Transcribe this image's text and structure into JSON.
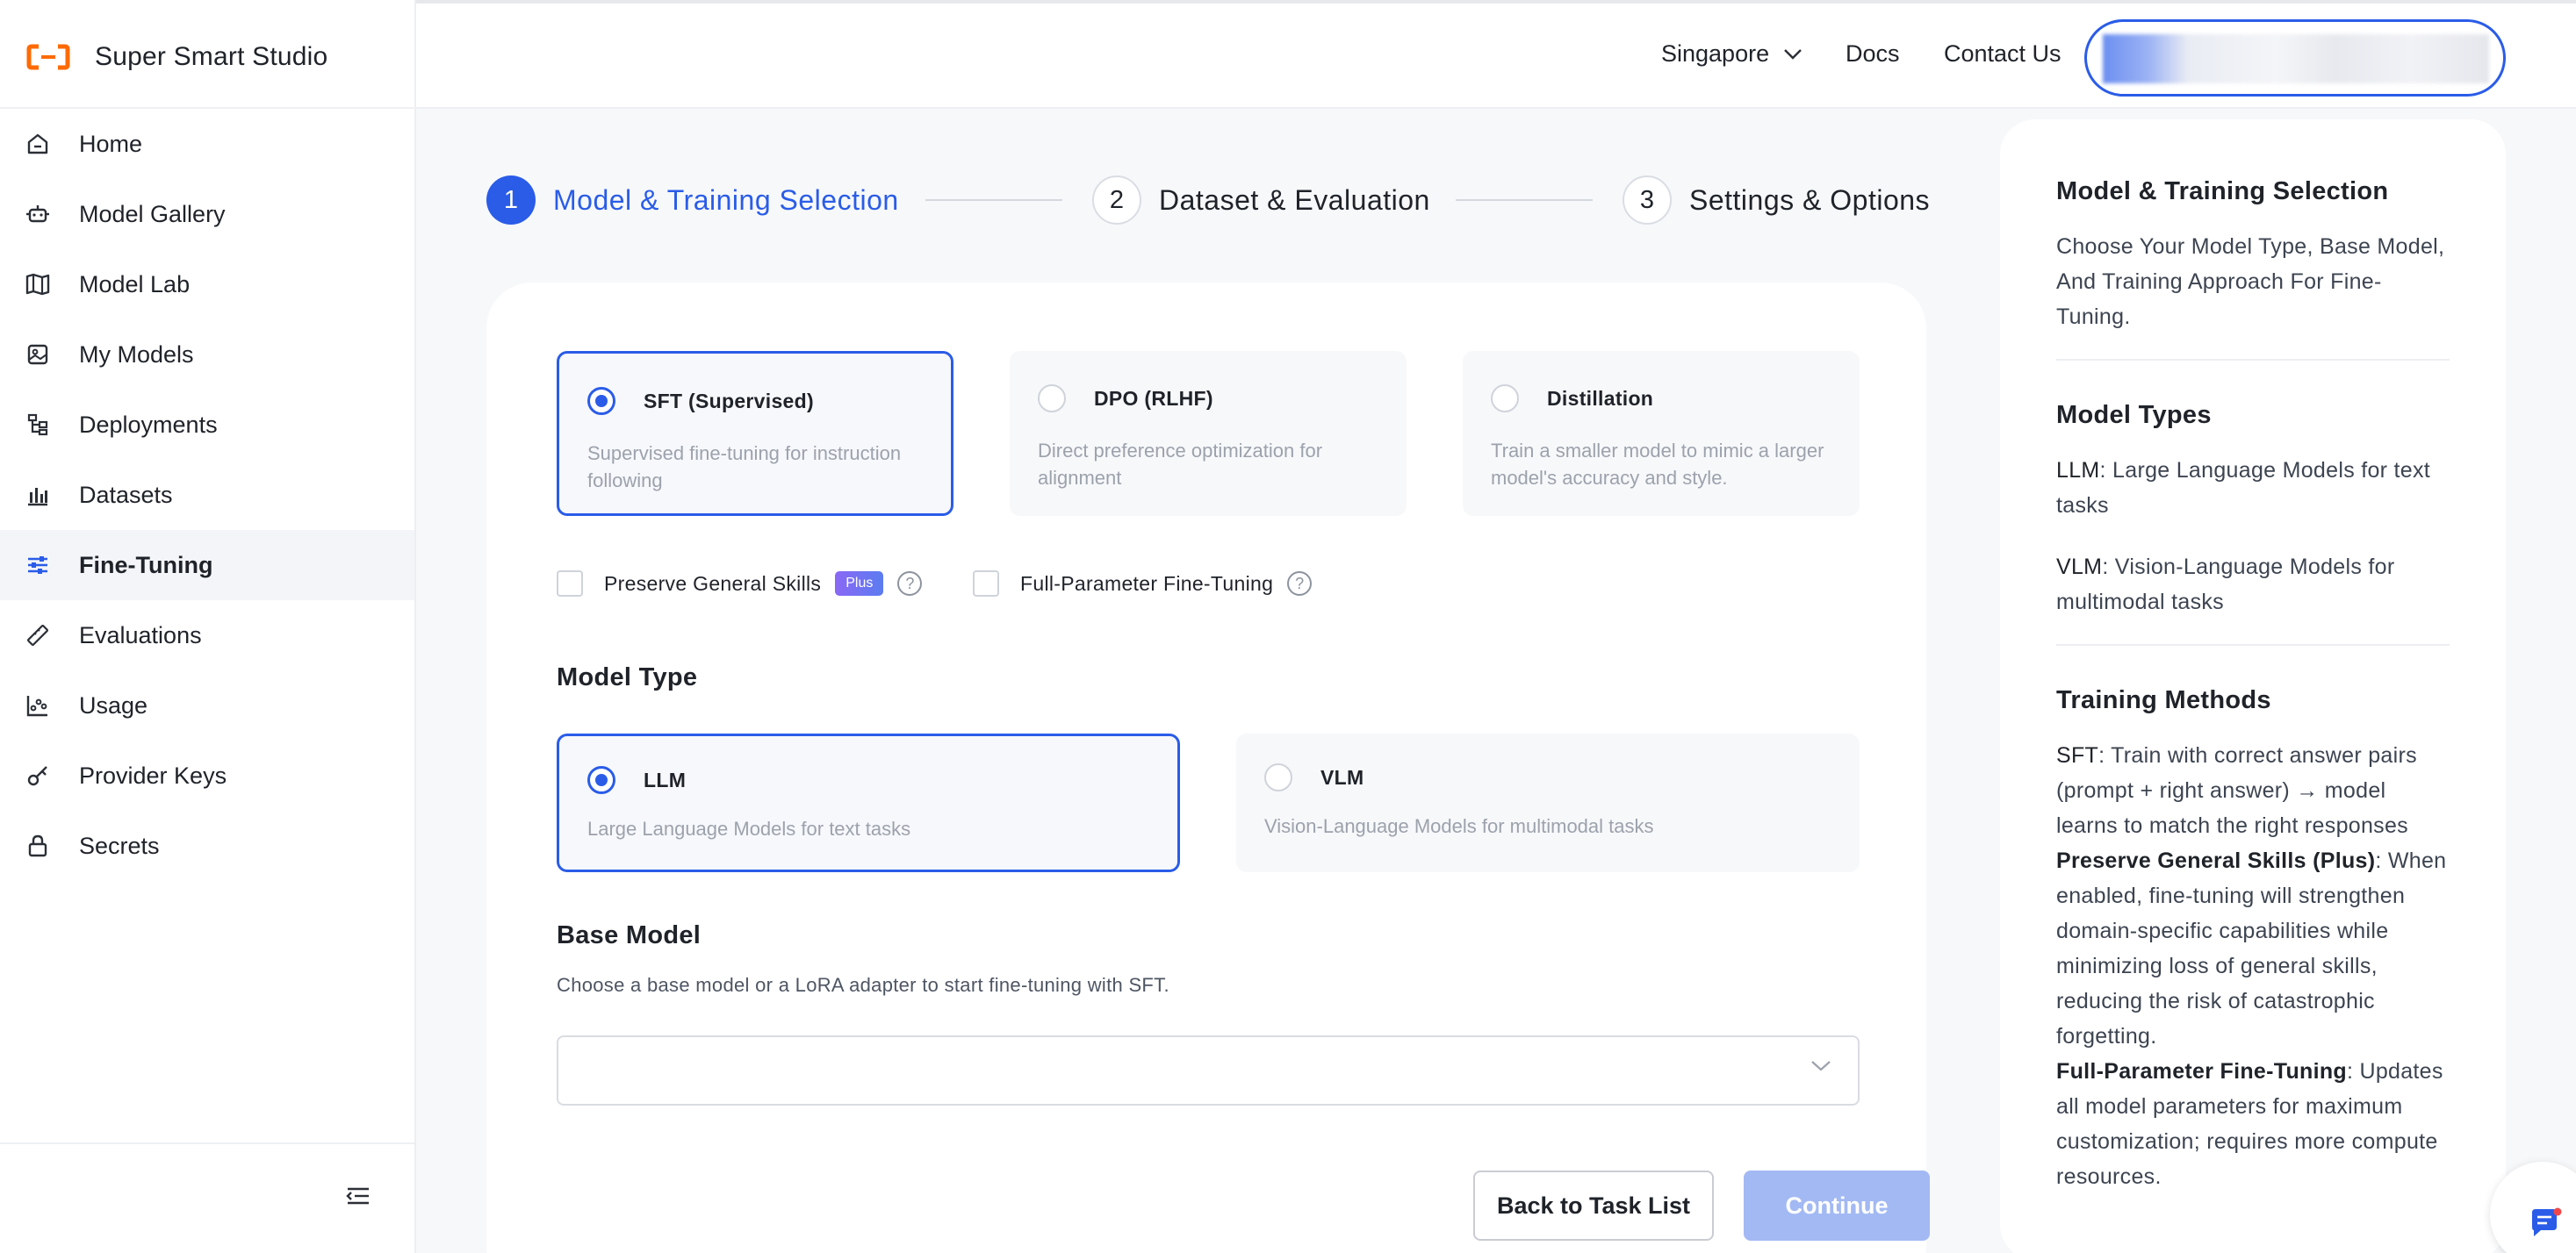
{
  "app": {
    "title": "Super Smart Studio"
  },
  "sidebar": {
    "items": [
      {
        "label": "Home",
        "icon": "home-icon",
        "active": false
      },
      {
        "label": "Model Gallery",
        "icon": "robot-icon",
        "active": false
      },
      {
        "label": "Model Lab",
        "icon": "map-icon",
        "active": false
      },
      {
        "label": "My Models",
        "icon": "model-icon",
        "active": false
      },
      {
        "label": "Deployments",
        "icon": "deployments-icon",
        "active": false
      },
      {
        "label": "Datasets",
        "icon": "bar-chart-icon",
        "active": false
      },
      {
        "label": "Fine-Tuning",
        "icon": "sliders-icon",
        "active": true
      },
      {
        "label": "Evaluations",
        "icon": "ruler-icon",
        "active": false
      },
      {
        "label": "Usage",
        "icon": "usage-chart-icon",
        "active": false
      },
      {
        "label": "Provider Keys",
        "icon": "key-icon",
        "active": false
      },
      {
        "label": "Secrets",
        "icon": "lock-icon",
        "active": false
      }
    ]
  },
  "header": {
    "region": "Singapore",
    "docs": "Docs",
    "contact": "Contact Us"
  },
  "stepper": {
    "steps": [
      {
        "num": "1",
        "label": "Model & Training Selection",
        "active": true
      },
      {
        "num": "2",
        "label": "Dataset & Evaluation",
        "active": false
      },
      {
        "num": "3",
        "label": "Settings & Options",
        "active": false
      }
    ]
  },
  "training": {
    "options": [
      {
        "title": "SFT (Supervised)",
        "desc": "Supervised fine-tuning for instruction following",
        "selected": true
      },
      {
        "title": "DPO (RLHF)",
        "desc": "Direct preference optimization for alignment",
        "selected": false
      },
      {
        "title": "Distillation",
        "desc": "Train a smaller model to mimic a larger model's accuracy and style.",
        "selected": false
      }
    ],
    "preserve_label": "Preserve General Skills",
    "plus_badge": "Plus",
    "full_param_label": "Full-Parameter Fine-Tuning"
  },
  "model_type": {
    "title": "Model Type",
    "options": [
      {
        "title": "LLM",
        "desc": "Large Language Models for text tasks",
        "selected": true
      },
      {
        "title": "VLM",
        "desc": "Vision-Language Models for multimodal tasks",
        "selected": false
      }
    ]
  },
  "base_model": {
    "title": "Base Model",
    "subtitle": "Choose a base model or a LoRA adapter to start fine-tuning with SFT.",
    "value": ""
  },
  "buttons": {
    "back": "Back to Task List",
    "continue": "Continue"
  },
  "info": {
    "s1_title": "Model & Training Selection",
    "s1_body": "Choose Your Model Type, Base Model, And Training Approach For Fine-Tuning.",
    "s2_title": "Model Types",
    "llm_term": "LLM",
    "llm_body": ": Large Language Models for text tasks",
    "vlm_term": "VLM",
    "vlm_body": ": Vision-Language Models for multimodal tasks",
    "s3_title": "Training Methods",
    "sft_term": "SFT",
    "sft_body": ": Train with correct answer pairs (prompt + right answer) → model learns to match the right responses",
    "pgs_term": "Preserve General Skills (Plus)",
    "pgs_body": ": When enabled, fine-tuning will strengthen domain-specific capabilities while minimizing loss of general skills, reducing the risk of catastrophic forgetting.",
    "fpft_term": "Full-Parameter Fine-Tuning",
    "fpft_body": ": Updates all model parameters for maximum customization; requires more compute resources."
  },
  "colors": {
    "accent": "#2a5ce8",
    "brand": "#ff6a00",
    "continue_disabled": "#a3b9f4"
  }
}
